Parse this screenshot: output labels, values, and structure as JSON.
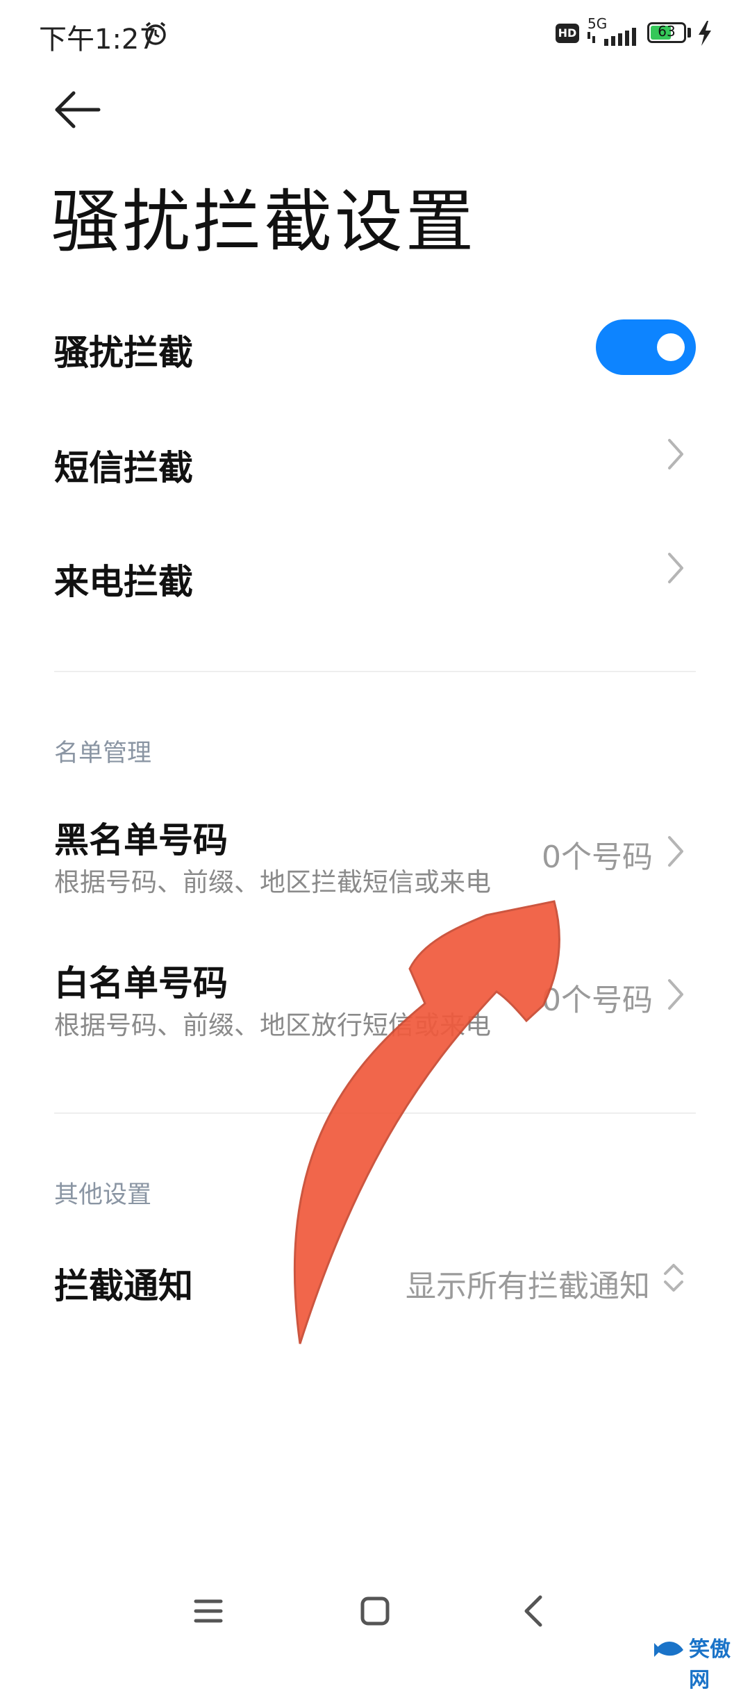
{
  "status_bar": {
    "time": "下午1:27",
    "hd_badge": "HD",
    "network": "5G",
    "battery_percent": "63",
    "battery_level": 0.63
  },
  "header": {
    "title": "骚扰拦截设置"
  },
  "rows": {
    "block": {
      "label": "骚扰拦截",
      "enabled": true
    },
    "sms": {
      "label": "短信拦截"
    },
    "call": {
      "label": "来电拦截"
    }
  },
  "list_management": {
    "section_title": "名单管理",
    "blacklist": {
      "label": "黑名单号码",
      "description": "根据号码、前缀、地区拦截短信或来电",
      "count": "0个号码"
    },
    "whitelist": {
      "label": "白名单号码",
      "description": "根据号码、前缀、地区放行短信或来电",
      "count": "0个号码"
    }
  },
  "other_settings": {
    "section_title": "其他设置",
    "notification": {
      "label": "拦截通知",
      "value": "显示所有拦截通知"
    }
  },
  "nav_bar": {
    "icons": [
      "menu-icon",
      "home-icon",
      "back-icon"
    ]
  },
  "watermark": {
    "text": "笑傲网"
  },
  "colors": {
    "accent": "#0d84ff",
    "arrow": "#f05a3c",
    "text_secondary": "#8a8a8a"
  }
}
